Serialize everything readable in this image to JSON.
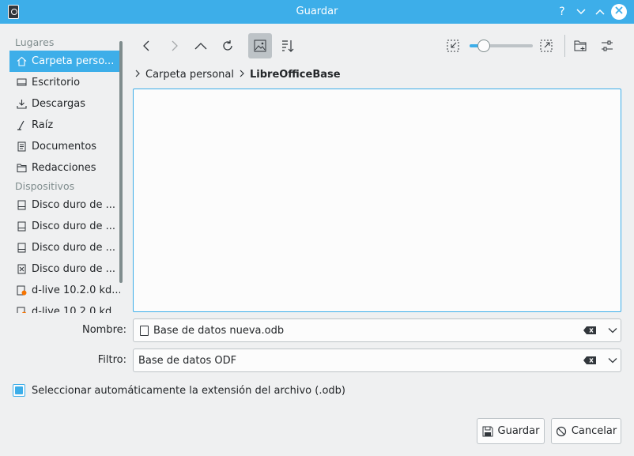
{
  "window": {
    "title": "Guardar",
    "help_glyph": "?"
  },
  "sidebar": {
    "sections": [
      {
        "label": "Lugares",
        "items": [
          {
            "label": "Carpeta perso...",
            "icon": "home-icon",
            "active": true
          },
          {
            "label": "Escritorio",
            "icon": "desktop-icon"
          },
          {
            "label": "Descargas",
            "icon": "download-icon"
          },
          {
            "label": "Raíz",
            "icon": "root-icon"
          },
          {
            "label": "Documentos",
            "icon": "documents-icon"
          },
          {
            "label": "Redacciones",
            "icon": "folder-icon"
          }
        ]
      },
      {
        "label": "Dispositivos",
        "items": [
          {
            "label": "Disco duro de ...",
            "icon": "harddisk-icon"
          },
          {
            "label": "Disco duro de ...",
            "icon": "harddisk-icon"
          },
          {
            "label": "Disco duro de ...",
            "icon": "harddisk-icon"
          },
          {
            "label": "Disco duro de ...",
            "icon": "harddisk-icon"
          },
          {
            "label": "d-live 10.2.0 kd...",
            "icon": "optical-disc-icon"
          },
          {
            "label": "d-live 10.2.0 kd...",
            "icon": "optical-disc-icon"
          }
        ]
      }
    ]
  },
  "toolbar": {
    "zoom_percent": 22
  },
  "breadcrumb": {
    "parent": "Carpeta personal",
    "current": "LibreOfficeBase"
  },
  "form": {
    "name_label": "Nombre:",
    "name_value": "Base de datos nueva.odb",
    "filter_label": "Filtro:",
    "filter_value": "Base de datos ODF"
  },
  "auto_extension": {
    "label": "Seleccionar automáticamente la extensión del archivo (.odb)",
    "checked": true
  },
  "buttons": {
    "save": "Guardar",
    "cancel": "Cancelar"
  },
  "colors": {
    "accent": "#3daee9",
    "window_bg": "#eff0f1",
    "text": "#232629"
  }
}
